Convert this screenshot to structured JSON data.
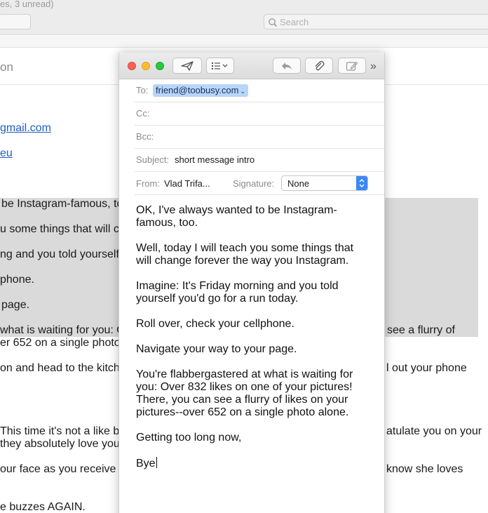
{
  "background": {
    "status_text": "es, 3 unread)",
    "search_placeholder": "Search",
    "header_word": "on",
    "links": [
      "gmail.com",
      "eu"
    ],
    "left_lines": [
      "be Instagram-famous, to",
      "u some things that will ch",
      "ng and you told yourself y",
      "phone.",
      "page.",
      "what is waiting for you: O",
      "er 652 on a single photo a",
      "on and head to the kitch",
      "This time it's not a like b",
      "they absolutely love you",
      "our face as you receive a",
      "e buzzes AGAIN."
    ],
    "right_lines": [
      "see a flurry of",
      "l out your phone",
      "atulate you on your",
      "know she loves"
    ]
  },
  "compose": {
    "toolbar": {
      "send_icon": "paper-plane-icon",
      "format_icon": "list-icon",
      "reply_icon": "reply-arrow-icon",
      "attach_icon": "paperclip-icon",
      "markup_icon": "markup-icon",
      "more_label": "»"
    },
    "to_label": "To:",
    "to_value": "friend@toobusy.com",
    "cc_label": "Cc:",
    "bcc_label": "Bcc:",
    "subject_label": "Subject:",
    "subject_value": "short message intro",
    "from_label": "From:",
    "from_value": "Vlad Trifa...",
    "signature_label": "Signature:",
    "signature_value": "None",
    "body_paragraphs": [
      "OK, I've always wanted to be Instagram-famous, too.",
      "Well, today I will teach you some things that will change forever the way you Instagram.",
      "Imagine: It's Friday morning and you told yourself you'd go for a run today.",
      "Roll over, check your cellphone.",
      "Navigate your way to your page.",
      "You're flabbergastered at what is waiting for you: Over 832 likes on one of your pictures! There, you can see a flurry of likes on your pictures--over 652 on a single photo alone.",
      "Getting too long now,",
      "Bye"
    ]
  },
  "colors": {
    "close": "#fc5f57",
    "minimize": "#fdbc2e",
    "zoom": "#28c840",
    "link": "#1f5fc4",
    "chip": "#b9d5f8",
    "stepper": "#3b87f7"
  }
}
